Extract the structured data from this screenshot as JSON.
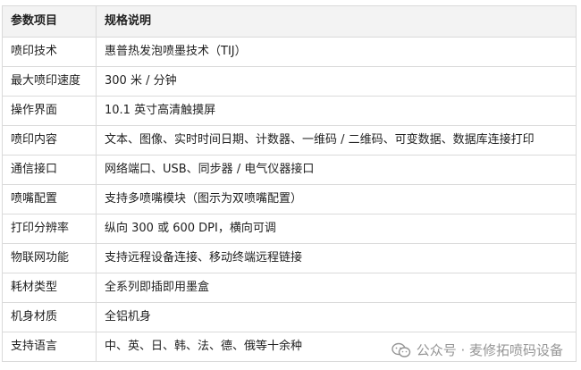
{
  "table": {
    "headers": [
      "参数项目",
      "规格说明"
    ],
    "rows": [
      [
        "喷印技术",
        "惠普热发泡喷墨技术（TIJ）"
      ],
      [
        "最大喷印速度",
        "300 米 / 分钟"
      ],
      [
        "操作界面",
        "10.1 英寸高清触摸屏"
      ],
      [
        "喷印内容",
        "文本、图像、实时时间日期、计数器、一维码 / 二维码、可变数据、数据库连接打印"
      ],
      [
        "通信接口",
        "网络端口、USB、同步器 / 电气仪器接口"
      ],
      [
        "喷嘴配置",
        "支持多喷嘴模块（图示为双喷嘴配置）"
      ],
      [
        "打印分辨率",
        "纵向 300 或 600 DPI，横向可调"
      ],
      [
        "物联网功能",
        "支持远程设备连接、移动终端远程链接"
      ],
      [
        "耗材类型",
        "全系列即插即用墨盒"
      ],
      [
        "机身材质",
        "全铝机身"
      ],
      [
        "支持语言",
        "中、英、日、韩、法、德、俄等十余种"
      ]
    ]
  },
  "watermark": {
    "icon": "wechat-icon",
    "text": "公众号 · 麦修拓喷码设备"
  }
}
